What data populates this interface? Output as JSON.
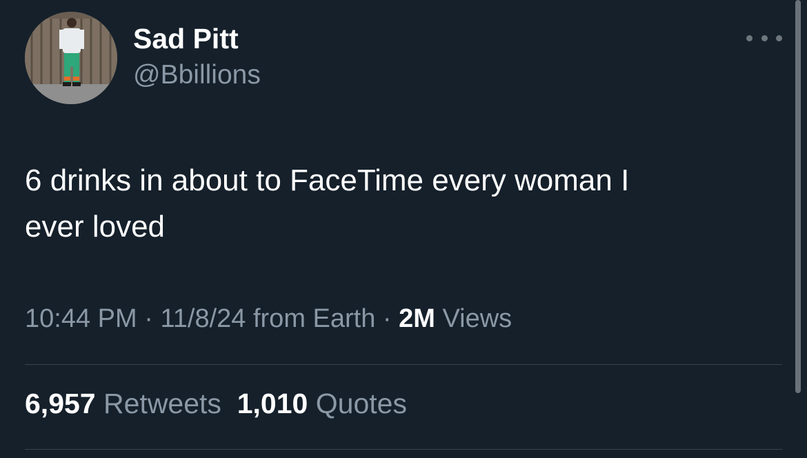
{
  "author": {
    "display_name": "Sad Pitt",
    "handle": "@Bbillions"
  },
  "tweet": {
    "text_line1": "6 drinks in about to FaceTime every woman I",
    "text_line2": "ever loved"
  },
  "meta": {
    "time": "10:44 PM",
    "date": "11/8/24",
    "source": "from Earth",
    "separator": " · ",
    "views_count": "2M",
    "views_label": "Views"
  },
  "stats": {
    "retweets_count": "6,957",
    "retweets_label": "Retweets",
    "quotes_count": "1,010",
    "quotes_label": "Quotes"
  },
  "icons": {
    "more": "more-horizontal-icon"
  },
  "colors": {
    "background": "#15202b",
    "primary_text": "#ffffff",
    "secondary_text": "#8b98a5",
    "divider": "#38444d"
  }
}
